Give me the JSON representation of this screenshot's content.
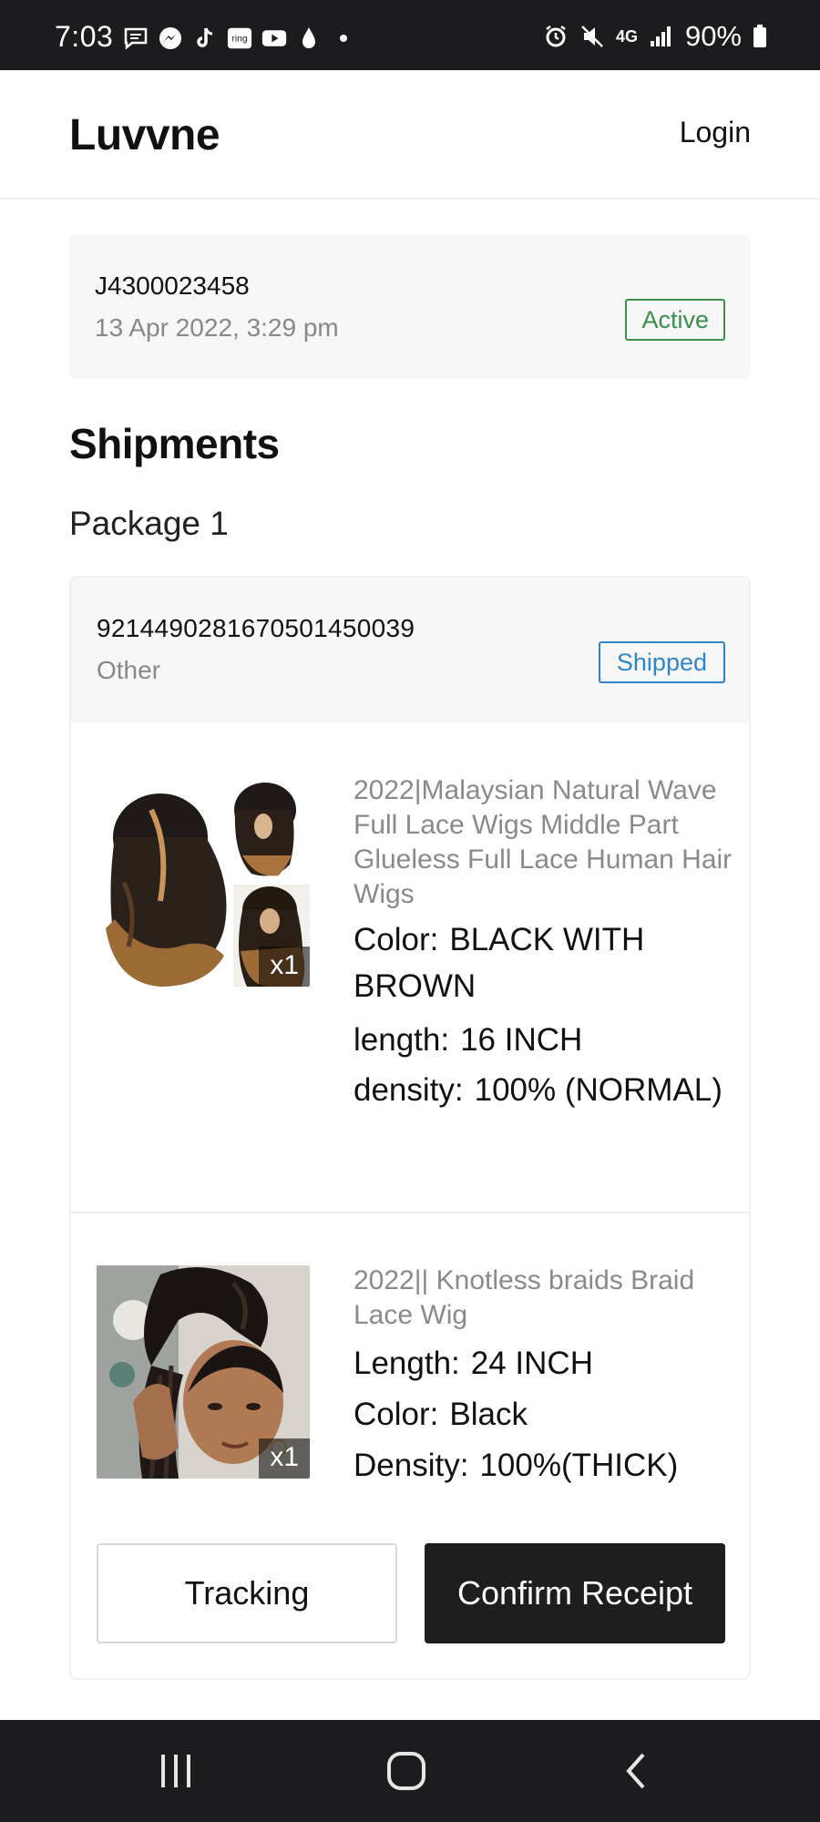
{
  "status_bar": {
    "time": "7:03",
    "left_icons": [
      "message-icon",
      "messenger-icon",
      "tiktok-icon",
      "ring-icon",
      "youtube-icon",
      "drop-icon",
      "dot-icon"
    ],
    "ring_label": "ring",
    "network": "4G",
    "battery": "90%"
  },
  "header": {
    "brand": "Luvvne",
    "login": "Login"
  },
  "order": {
    "id": "J4300023458",
    "date": "13 Apr 2022, 3:29 pm",
    "status": "Active",
    "status_color": "#3a8f4f"
  },
  "shipments": {
    "title": "Shipments",
    "package_label": "Package 1",
    "tracking_number": "9214490281670501450039",
    "carrier": "Other",
    "status": "Shipped",
    "status_color": "#2e86c9",
    "items": [
      {
        "title": "2022|Malaysian Natural Wave Full Lace Wigs Middle Part Glueless Full Lace Human Hair Wigs",
        "qty": "x1",
        "attributes": [
          {
            "key": "Color:",
            "value": "BLACK WITH BROWN"
          },
          {
            "key": "length:",
            "value": "16 INCH"
          },
          {
            "key": "density:",
            "value": "100% (NORMAL)"
          }
        ]
      },
      {
        "title": "2022|| Knotless braids Braid Lace Wig",
        "qty": "x1",
        "attributes": [
          {
            "key": "Length:",
            "value": "24 INCH"
          },
          {
            "key": "Color:",
            "value": "Black"
          },
          {
            "key": "Density:",
            "value": "100%(THICK)"
          }
        ]
      }
    ]
  },
  "actions": {
    "tracking": "Tracking",
    "confirm": "Confirm Receipt"
  }
}
